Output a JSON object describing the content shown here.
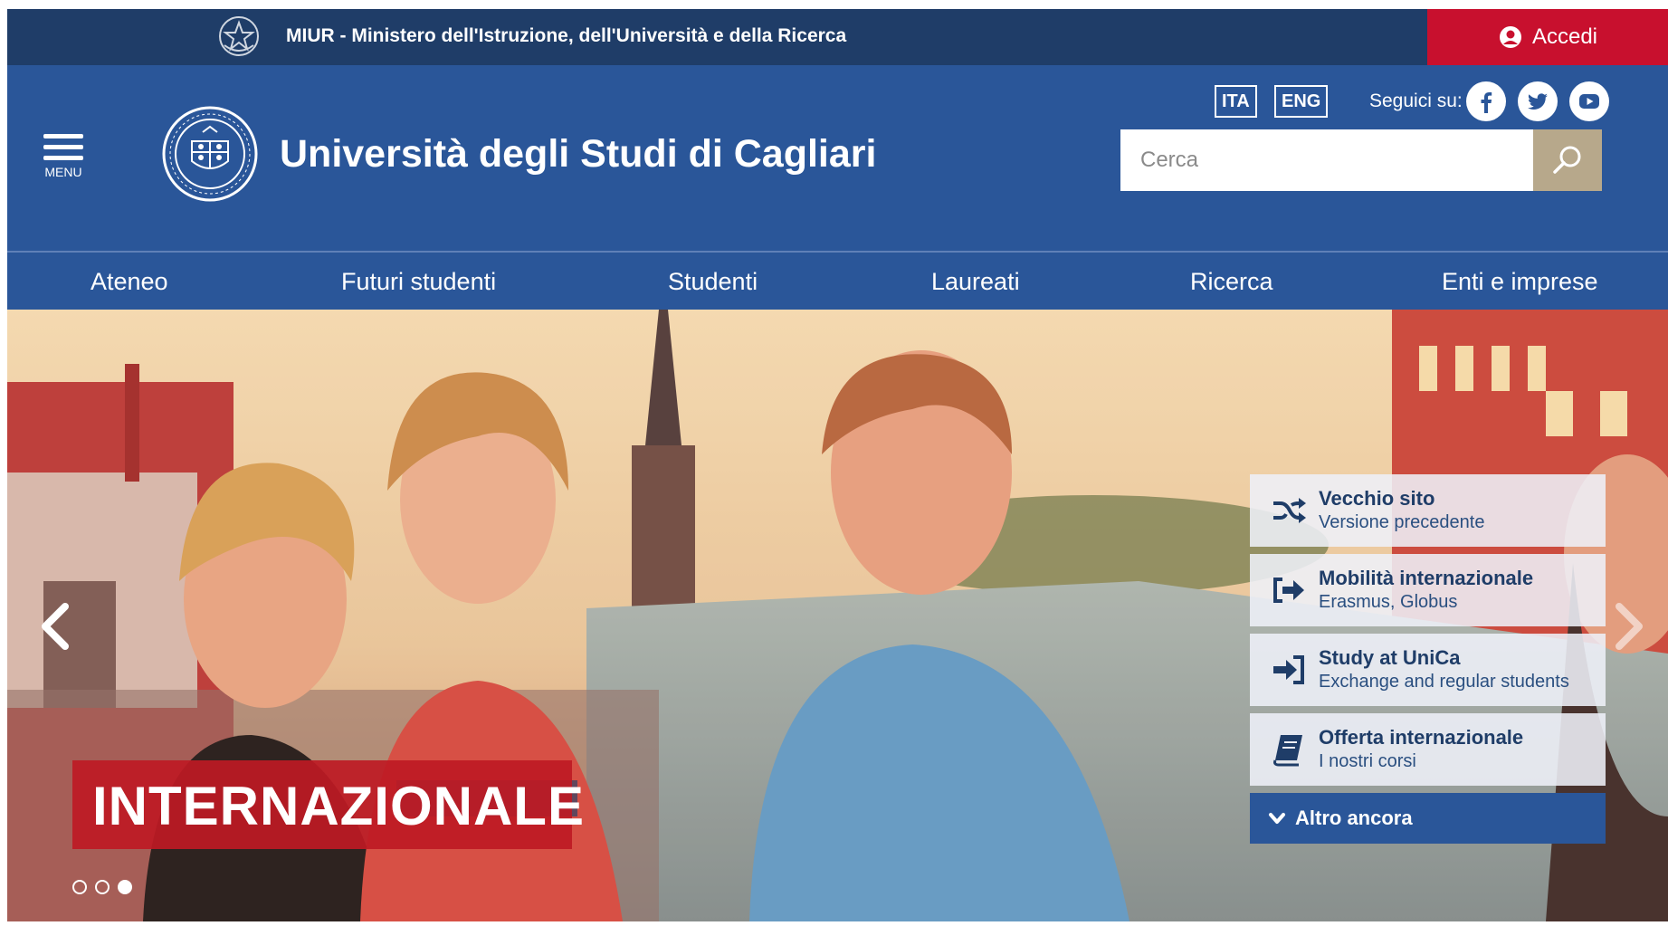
{
  "topbar": {
    "miur_text": "MIUR - Ministero dell'Istruzione, dell'Università e della Ricerca",
    "login_label": "Accedi",
    "bg_color": "#1f3d68",
    "login_color": "#c8102e"
  },
  "header": {
    "menu_label": "MENU",
    "title": "Università degli Studi di Cagliari",
    "lang_ita": "ITA",
    "lang_eng": "ENG",
    "follow_label": "Seguici su:",
    "social": [
      "facebook-icon",
      "twitter-icon",
      "youtube-icon"
    ],
    "search_placeholder": "Cerca",
    "brand_color": "#2a5699",
    "search_button_color": "#b7a88b"
  },
  "nav": {
    "items": [
      {
        "label": "Ateneo"
      },
      {
        "label": "Futuri studenti"
      },
      {
        "label": "Studenti"
      },
      {
        "label": "Laureati"
      },
      {
        "label": "Ricerca"
      },
      {
        "label": "Enti e imprese"
      }
    ]
  },
  "hero": {
    "banner_text": "INTERNAZIONALE",
    "banner_color": "#be1a24",
    "slides_total": 3,
    "active_slide": 3,
    "quick_links": [
      {
        "title": "Vecchio sito",
        "subtitle": "Versione precedente",
        "icon": "shuffle-icon"
      },
      {
        "title": "Mobilità internazionale",
        "subtitle": "Erasmus, Globus",
        "icon": "share-arrow-icon"
      },
      {
        "title": "Study at UniCa",
        "subtitle": "Exchange and regular students",
        "icon": "sign-in-icon"
      },
      {
        "title": "Offerta internazionale",
        "subtitle": "I nostri corsi",
        "icon": "book-icon"
      }
    ],
    "more_label": "Altro ancora"
  }
}
